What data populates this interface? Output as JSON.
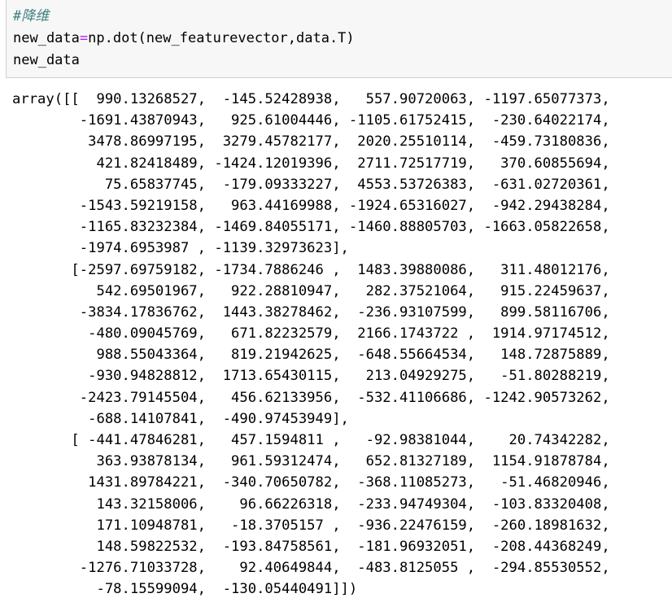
{
  "input_cell": {
    "comment": "#降维",
    "line_assign_lhs": "new_data",
    "line_assign_op": "=",
    "line_assign_rhs": "np.dot(new_featurevector,data.T)",
    "line_echo": "new_data"
  },
  "output": {
    "lines": [
      "array([[  990.13268527,  -145.52428938,   557.90720063, -1197.65077373,",
      "        -1691.43870943,   925.61004446, -1105.61752415,  -230.64022174,",
      "         3478.86997195,  3279.45782177,  2020.25510114,  -459.73180836,",
      "          421.82418489, -1424.12019396,  2711.72517719,   370.60855694,",
      "           75.65837745,  -179.09333227,  4553.53726383,  -631.02720361,",
      "        -1543.59219158,   963.44169988, -1924.65316027,  -942.29438284,",
      "        -1165.83232384, -1469.84055171, -1460.88805703, -1663.05822658,",
      "        -1974.6953987 , -1139.32973623],",
      "       [-2597.69759182, -1734.7886246 ,  1483.39880086,   311.48012176,",
      "          542.69501967,   922.28810947,   282.37521064,   915.22459637,",
      "        -3834.17836762,  1443.38278462,  -236.93107599,   899.58116706,",
      "         -480.09045769,   671.82232579,  2166.1743722 ,  1914.97174512,",
      "          988.55043364,   819.21942625,  -648.55664534,   148.72875889,",
      "         -930.94828812,  1713.65430115,   213.04929275,   -51.80288219,",
      "        -2423.79145504,   456.62133956,  -532.41106686, -1242.90573262,",
      "         -688.14107841,  -490.97453949],",
      "       [ -441.47846281,   457.1594811 ,   -92.98381044,    20.74342282,",
      "          363.93878134,   961.59312474,   652.81327189,  1154.91878784,",
      "         1431.89784221,  -340.70650782,  -368.11085273,   -51.46820946,",
      "          143.32158006,    96.66226318,  -233.94749304,  -103.83320408,",
      "          171.10948781,   -18.3705157 ,  -936.22476159,  -260.18981632,",
      "          148.59822532,  -193.84758561,  -181.96932051,  -208.44368249,",
      "        -1276.71033728,    92.40649844,  -483.8125055 ,  -294.85530552,",
      "          -78.15599094,  -130.05440491]])"
    ]
  }
}
